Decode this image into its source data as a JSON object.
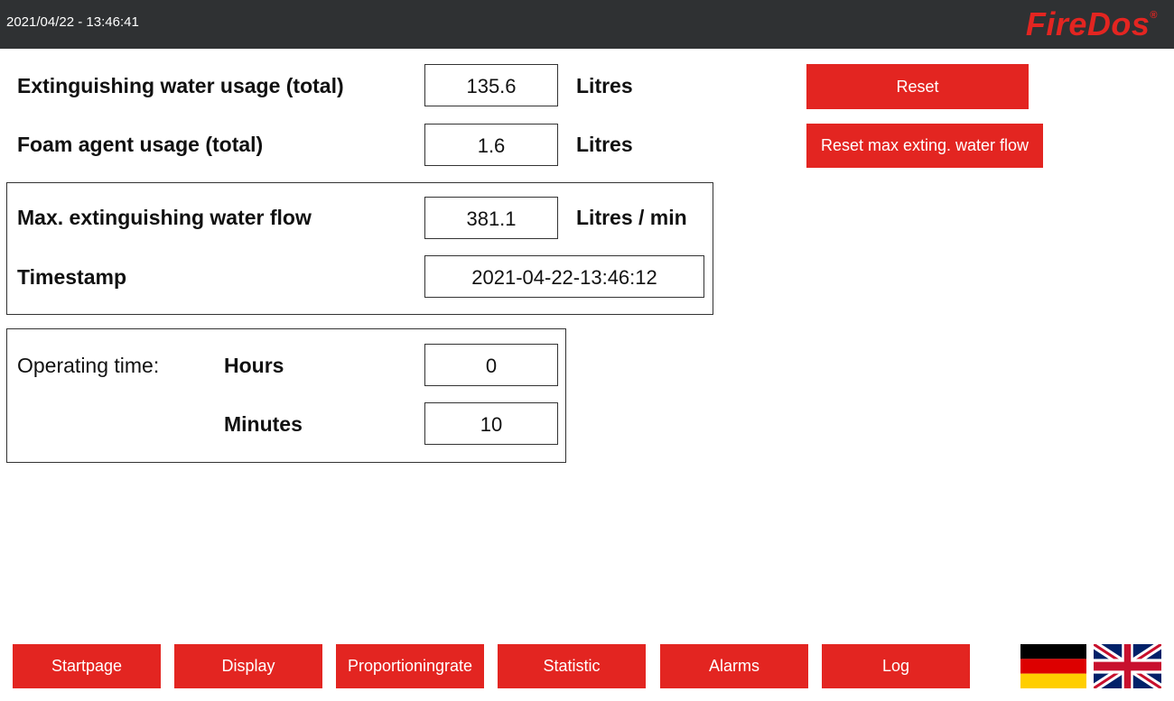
{
  "header": {
    "datetime": "2021/04/22 - 13:46:41",
    "brand": "FireDos",
    "brand_mark": "®"
  },
  "totals": {
    "water_label": "Extinguishing water usage (total)",
    "water_value": "135.6",
    "water_unit": "Litres",
    "foam_label": "Foam agent usage (total)",
    "foam_value": "1.6",
    "foam_unit": "Litres"
  },
  "max_flow": {
    "label": "Max. extinguishing water flow",
    "value": "381.1",
    "unit": "Litres / min",
    "timestamp_label": "Timestamp",
    "timestamp_value": "2021-04-22-13:46:12"
  },
  "operating_time": {
    "label": "Operating time:",
    "hours_label": "Hours",
    "hours_value": "0",
    "minutes_label": "Minutes",
    "minutes_value": "10"
  },
  "actions": {
    "reset": "Reset",
    "reset_max_flow": "Reset max exting. water flow"
  },
  "nav": {
    "startpage": "Startpage",
    "display": "Display",
    "proportioningrate": "Proportioningrate",
    "statistic": "Statistic",
    "alarms": "Alarms",
    "log": "Log"
  },
  "languages": [
    "german-flag",
    "uk-flag"
  ],
  "colors": {
    "accent": "#e32521",
    "header_bg": "#2f3133"
  }
}
